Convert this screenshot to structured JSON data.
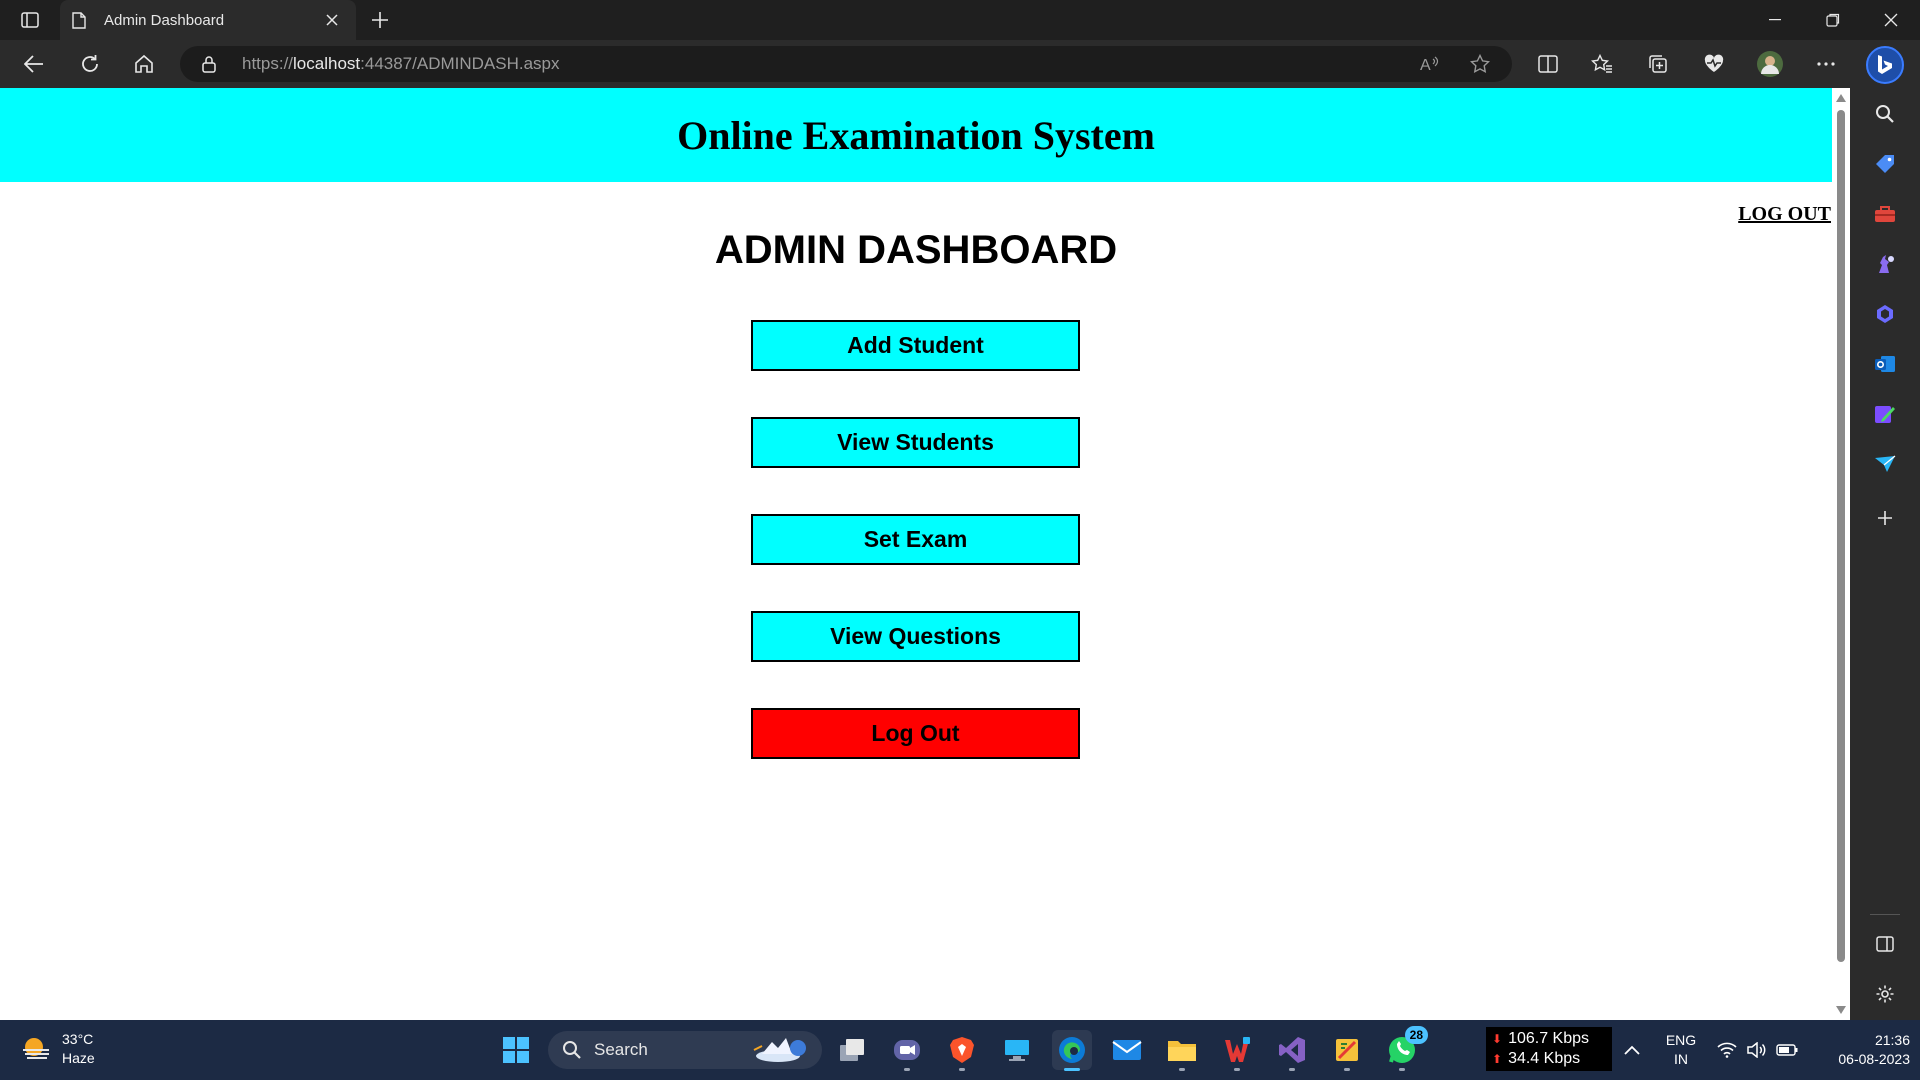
{
  "browser": {
    "tab_title": "Admin Dashboard",
    "url_scheme": "https://",
    "url_host": "localhost",
    "url_rest": ":44387/ADMINDASH.aspx"
  },
  "page": {
    "site_title": "Online Examination System",
    "logout_link": "LOG OUT",
    "dashboard_title": "ADMIN DASHBOARD",
    "buttons": [
      {
        "label": "Add Student"
      },
      {
        "label": "View Students"
      },
      {
        "label": "Set Exam"
      },
      {
        "label": "View Questions"
      },
      {
        "label": "Log Out"
      }
    ],
    "colors": {
      "header_bg": "#00ffff",
      "button_bg": "#00ffff",
      "logout_button_bg": "#ff0000"
    }
  },
  "taskbar": {
    "weather_temp": "33°C",
    "weather_desc": "Haze",
    "search_placeholder": "Search",
    "net_down": "106.7 Kbps",
    "net_up": "34.4 Kbps",
    "lang_line1": "ENG",
    "lang_line2": "IN",
    "time": "21:36",
    "date": "06-08-2023",
    "whatsapp_badge": "28"
  }
}
